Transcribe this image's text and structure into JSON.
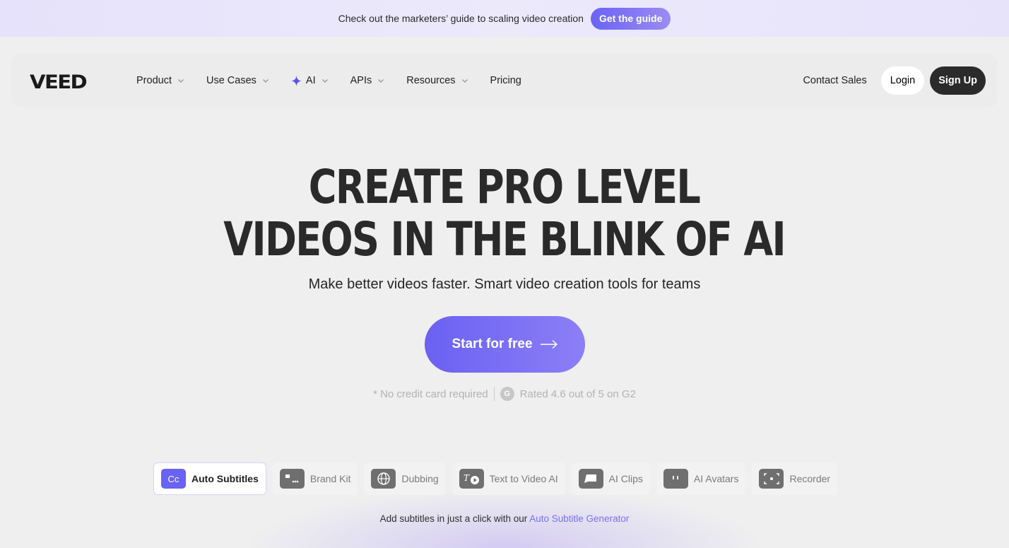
{
  "banner": {
    "text": "Check out the marketers’ guide to scaling video creation",
    "button_label": "Get the guide"
  },
  "nav": {
    "logo": "VEED",
    "items": [
      {
        "label": "Product",
        "has_dropdown": true
      },
      {
        "label": "Use Cases",
        "has_dropdown": true
      },
      {
        "label": "AI",
        "has_dropdown": true,
        "icon": "sparkle-icon"
      },
      {
        "label": "APIs",
        "has_dropdown": true
      },
      {
        "label": "Resources",
        "has_dropdown": true
      },
      {
        "label": "Pricing",
        "has_dropdown": false
      }
    ],
    "contact_label": "Contact Sales",
    "login_label": "Login",
    "signup_label": "Sign Up"
  },
  "hero": {
    "title_line1": "CREATE PRO LEVEL",
    "title_line2": "VIDEOS IN THE BLINK OF AI",
    "subtitle": "Make better videos faster. Smart video creation tools for teams",
    "cta_label": "Start for free",
    "no_card": "* No credit card required",
    "rating": "Rated 4.6 out of 5 on G2"
  },
  "tools": [
    {
      "label": "Auto Subtitles",
      "icon": "cc-icon",
      "active": true
    },
    {
      "label": "Brand Kit",
      "icon": "brand-kit-icon",
      "active": false
    },
    {
      "label": "Dubbing",
      "icon": "globe-icon",
      "active": false
    },
    {
      "label": "Text to Video AI",
      "icon": "text-to-video-icon",
      "active": false
    },
    {
      "label": "AI Clips",
      "icon": "clips-icon",
      "active": false
    },
    {
      "label": "AI Avatars",
      "icon": "avatar-icon",
      "active": false
    },
    {
      "label": "Recorder",
      "icon": "recorder-icon",
      "active": false
    }
  ],
  "tool_description": {
    "text": "Add subtitles in just a click with our",
    "link": "Auto Subtitle Generator"
  },
  "colors": {
    "accent": "#6a61f3",
    "banner_bg": "#e8e4fb",
    "signup_bg": "#2b2b2b"
  }
}
